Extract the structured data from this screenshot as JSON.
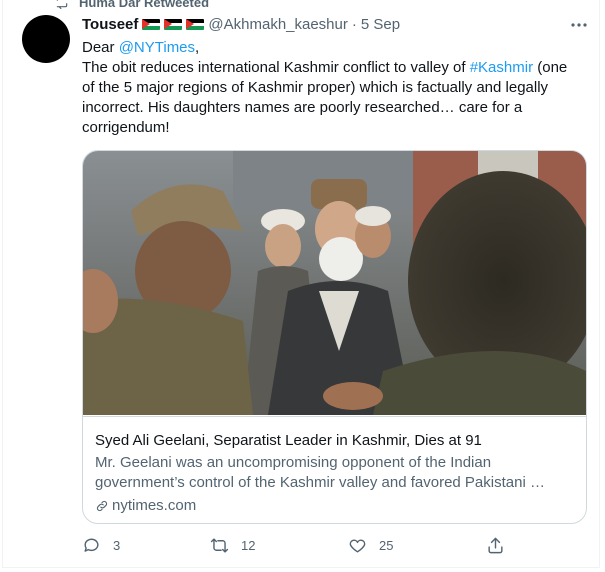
{
  "retweet": {
    "label": "Huma Dar Retweeted",
    "icon": "retweet-icon"
  },
  "tweet": {
    "author_name": "Touseef",
    "author_flags": [
      "palestine-flag",
      "palestine-flag",
      "palestine-flag"
    ],
    "handle": "@Akhmakh_kaeshur",
    "separator": "·",
    "timestamp": "5 Sep",
    "more_icon": "more-icon",
    "text": {
      "greeting": "Dear ",
      "mention": "@NYTimes",
      "greeting_end": ",",
      "body_start": "The obit reduces international Kashmir conflict to valley of ",
      "hashtag": "#Kashmir",
      "body_end": " (one of the 5 major regions of Kashmir proper) which is factually and legally incorrect. His daughters names are poorly researched… care for a corrigendum!"
    }
  },
  "link_card": {
    "title": "Syed Ali Geelani, Separatist Leader in Kashmir, Dies at 91",
    "description": "Mr. Geelani was an uncompromising opponent of the Indian government’s control of the Kashmir valley and favored Pakistani …",
    "domain": "nytimes.com",
    "domain_icon": "link-icon"
  },
  "actions": {
    "reply_count": "3",
    "retweet_count": "12",
    "like_count": "25",
    "reply_icon": "reply-icon",
    "retweet_icon": "retweet-icon",
    "like_icon": "like-icon",
    "share_icon": "share-icon"
  },
  "colors": {
    "accent": "#1d9bf0",
    "secondary_text": "#536471",
    "border": "#cfd9de"
  }
}
